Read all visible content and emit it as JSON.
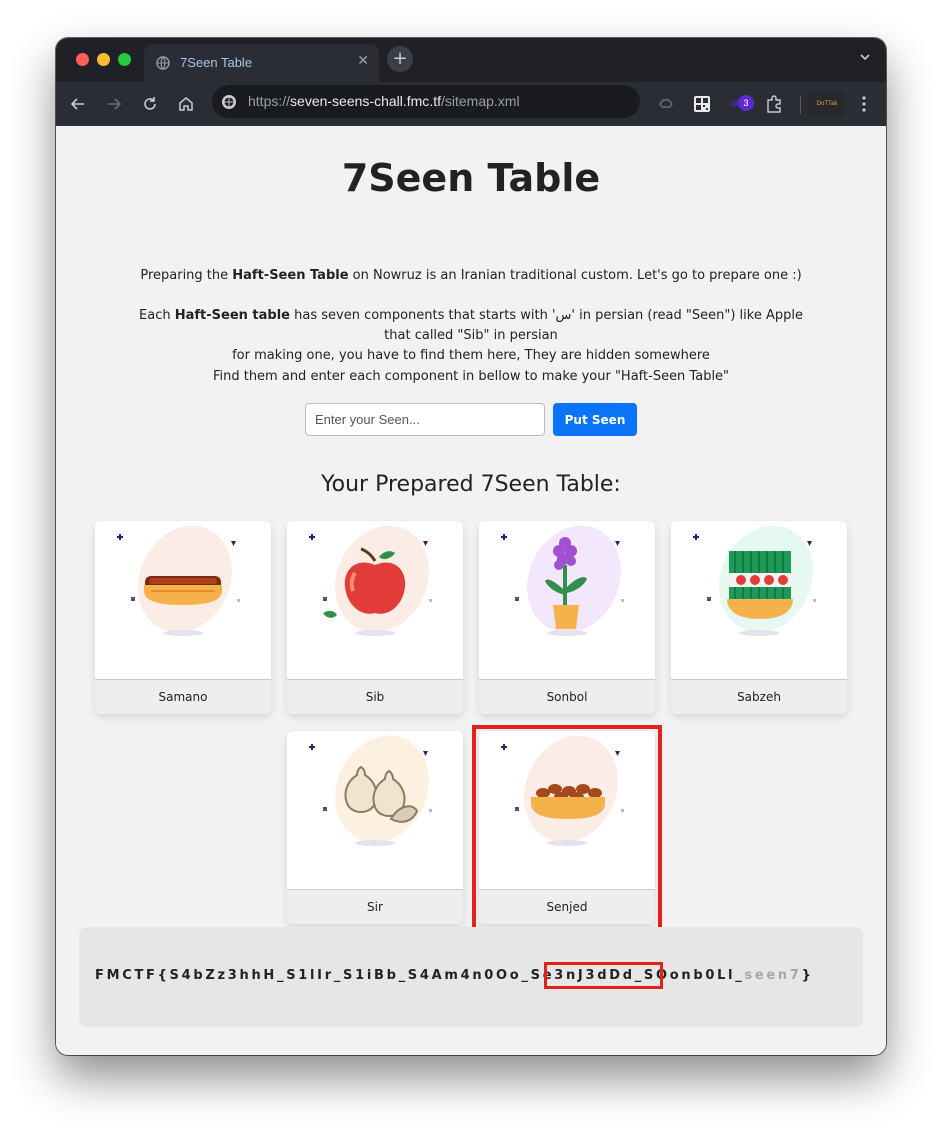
{
  "browser": {
    "tab_title": "7Seen Table",
    "new_tab_symbol": "+",
    "url_scheme": "https://",
    "url_host": "seven-seens-chall.fmc.tf",
    "url_path": "/sitemap.xml",
    "extension_badge_count": "3",
    "profile_label": "DoTTak"
  },
  "page": {
    "title": "7Seen Table",
    "intro_before": "Preparing the ",
    "intro_bold": "Haft-Seen Table",
    "intro_after": " on Nowruz is an Iranian traditional custom. Let's go to prepare one :)",
    "line2_before": "Each ",
    "line2_bold": "Haft-Seen table",
    "line2_after": " has seven components that starts with 'س' in persian (read \"Seen\") like Apple",
    "line3": "that called \"Sib\" in persian",
    "line4": "for making one, you have to find them here, They are hidden somewhere",
    "line5": "Find them and enter each component in bellow to make your \"Haft-Seen Table\"",
    "input_placeholder": "Enter your Seen...",
    "button_label": "Put Seen",
    "table_heading": "Your Prepared 7Seen Table:"
  },
  "items": [
    {
      "label": "Samano",
      "icon": "samanu-pudding-icon"
    },
    {
      "label": "Sib",
      "icon": "apple-icon"
    },
    {
      "label": "Sonbol",
      "icon": "hyacinth-icon"
    },
    {
      "label": "Sabzeh",
      "icon": "sprouts-icon"
    },
    {
      "label": "Sir",
      "icon": "garlic-icon"
    },
    {
      "label": "Senjed",
      "icon": "senjed-fruit-icon"
    }
  ],
  "flag": {
    "part1": "FMCTF{S4bZz3hhH_S1lIr_S1iBb_S4Am4n0Oo_",
    "part2": "Se3nJ3dDd",
    "part3": "_SOonb0Ll_",
    "part4": "seen7",
    "part5": "}"
  },
  "colors": {
    "accent_button": "#0a74f8",
    "highlight_red": "#e3211d"
  }
}
